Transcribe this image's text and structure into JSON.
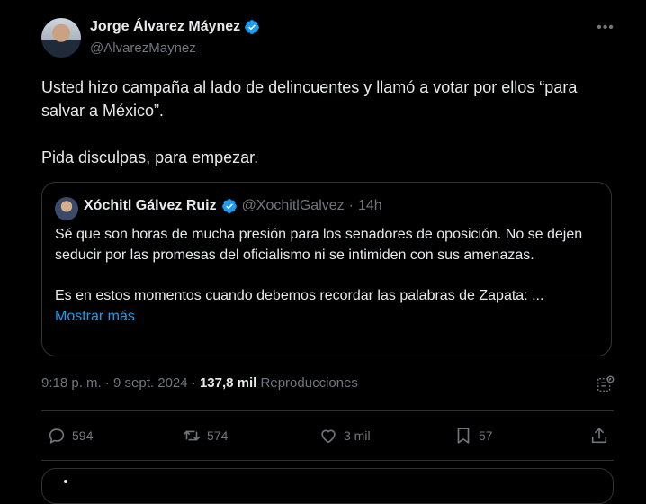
{
  "post": {
    "author": {
      "name": "Jorge Álvarez Máynez",
      "handle": "@AlvarezMaynez",
      "verified_color": "#1d9bf0"
    },
    "text": [
      "Usted hizo campaña al lado de delincuentes y llamó a votar por ellos “para salvar a México”.",
      "Pida disculpas, para empezar."
    ],
    "quote": {
      "name": "Xóchitl Gálvez Ruiz",
      "handle": "@XochitlGalvez",
      "separator": "·",
      "time": "14h",
      "text": [
        "Sé que son horas de mucha presión para los senadores de oposición. No se dejen seducir por las promesas del oficialismo ni se intimiden con sus amenazas.",
        "Es en estos momentos cuando debemos recordar las palabras de Zapata: ..."
      ],
      "show_more": "Mostrar más"
    },
    "meta": {
      "time": "9:18 p. m.",
      "separator": "·",
      "date": "9 sept. 2024",
      "views": "137,8 mil",
      "views_label": "Reproducciones"
    },
    "actions": {
      "replies": "594",
      "reposts": "574",
      "likes": "3 mil",
      "bookmarks": "57"
    },
    "icons": [
      "more-icon",
      "verified-icon",
      "analytics-icon",
      "reply-icon",
      "repost-icon",
      "like-icon",
      "bookmark-icon",
      "share-icon"
    ],
    "colors": {
      "background": "#000000",
      "text": "#e7e9ea",
      "muted": "#71767b",
      "accent": "#1d9bf0",
      "border": "#2f3336"
    }
  }
}
